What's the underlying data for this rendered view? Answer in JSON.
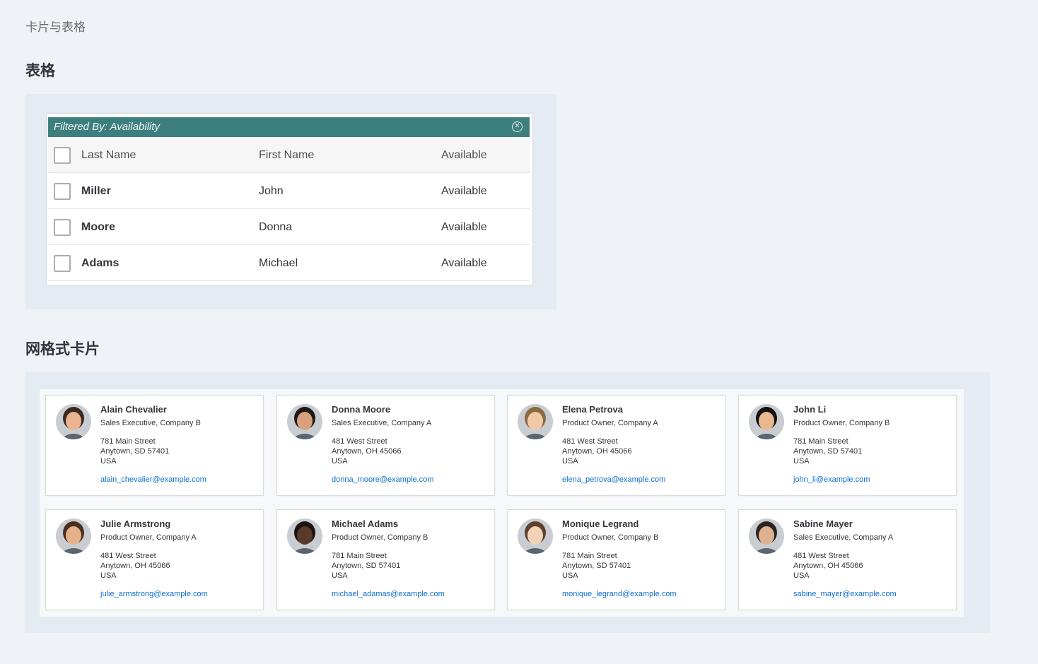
{
  "page": {
    "title": "卡片与表格"
  },
  "sections": {
    "table_title": "表格",
    "cards_title": "网格式卡片"
  },
  "table": {
    "filter_label": "Filtered By: Availability",
    "filter_close_icon": "close-circle-icon",
    "columns": [
      "Last Name",
      "First Name",
      "Available"
    ],
    "rows": [
      {
        "last": "Miller",
        "first": "John",
        "available": "Available"
      },
      {
        "last": "Moore",
        "first": "Donna",
        "available": "Available"
      },
      {
        "last": "Adams",
        "first": "Michael",
        "available": "Available"
      }
    ]
  },
  "cards": [
    {
      "name": "Alain Chevalier",
      "role": "Sales Executive, Company B",
      "street": "781 Main Street",
      "city": "Anytown, SD 57401",
      "country": "USA",
      "email": "alain_chevalier@example.com",
      "skin": "#e9b48f",
      "hair": "#3b2a20"
    },
    {
      "name": "Donna Moore",
      "role": "Sales Executive, Company A",
      "street": "481 West Street",
      "city": "Anytown, OH 45066",
      "country": "USA",
      "email": "donna_moore@example.com",
      "skin": "#d8a07c",
      "hair": "#1f1a17"
    },
    {
      "name": "Elena Petrova",
      "role": "Product Owner, Company A",
      "street": "481 West Street",
      "city": "Anytown, OH 45066",
      "country": "USA",
      "email": "elena_petrova@example.com",
      "skin": "#f0c9a6",
      "hair": "#8a6a3f"
    },
    {
      "name": "John Li",
      "role": "Product Owner, Company B",
      "street": "781 Main Street",
      "city": "Anytown, SD 57401",
      "country": "USA",
      "email": "john_li@example.com",
      "skin": "#e8b98f",
      "hair": "#151312"
    },
    {
      "name": "Julie Armstrong",
      "role": "Product Owner, Company A",
      "street": "481 West Street",
      "city": "Anytown, OH 45066",
      "country": "USA",
      "email": "julie_armstrong@example.com",
      "skin": "#e5b18a",
      "hair": "#4a2f1f"
    },
    {
      "name": "Michael Adams",
      "role": "Product Owner, Company B",
      "street": "781 Main Street",
      "city": "Anytown, SD 57401",
      "country": "USA",
      "email": "michael_adamas@example.com",
      "skin": "#5a3a2a",
      "hair": "#1a1311"
    },
    {
      "name": "Monique Legrand",
      "role": "Product Owner, Company B",
      "street": "781 Main Street",
      "city": "Anytown, SD 57401",
      "country": "USA",
      "email": "monique_legrand@example.com",
      "skin": "#f3d1b6",
      "hair": "#5d4030"
    },
    {
      "name": "Sabine Mayer",
      "role": "Sales Executive, Company A",
      "street": "481 West Street",
      "city": "Anytown, OH 45066",
      "country": "USA",
      "email": "sabine_mayer@example.com",
      "skin": "#dcb293",
      "hair": "#2c2420"
    }
  ],
  "colors": {
    "filter_bar": "#3d7f7f",
    "link": "#0a6ed1",
    "panel": "#e5ebf2",
    "background": "#eff2f6"
  }
}
